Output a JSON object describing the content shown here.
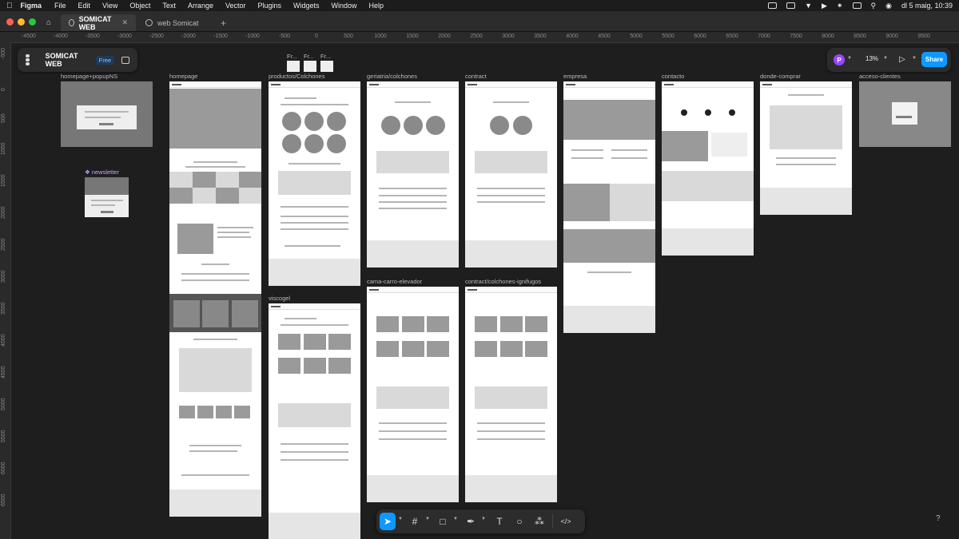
{
  "menubar": {
    "app": "Figma",
    "items": [
      "File",
      "Edit",
      "View",
      "Object",
      "Text",
      "Arrange",
      "Vector",
      "Plugins",
      "Widgets",
      "Window",
      "Help"
    ],
    "datetime": "dl 5 maig, 10:39"
  },
  "tabs": [
    {
      "label": "SOMICAT WEB",
      "active": true
    },
    {
      "label": "web Somicat",
      "active": false
    }
  ],
  "file": {
    "name": "SOMICAT WEB",
    "plan_badge": "Free"
  },
  "right_panel": {
    "avatar_initial": "P",
    "zoom": "13%",
    "share_label": "Share"
  },
  "ruler_h": [
    "-4500",
    "-4000",
    "-3500",
    "-3000",
    "-2500",
    "-2000",
    "-1500",
    "-1000",
    "-500",
    "0",
    "500",
    "1000",
    "1500",
    "2000",
    "2500",
    "3000",
    "3500",
    "4000",
    "4500",
    "5000",
    "5500",
    "6000",
    "6500",
    "7000",
    "7500",
    "8000",
    "8500",
    "9000",
    "9500"
  ],
  "ruler_v": [
    "-500",
    "0",
    "500",
    "1000",
    "1500",
    "2000",
    "2500",
    "3000",
    "3500",
    "4000",
    "4500",
    "5000",
    "5500",
    "6000",
    "6500"
  ],
  "frames": {
    "homepage_popup": "homepage+popupNS",
    "newsletter": "newsletter",
    "homepage": "homepage",
    "productos": "productos/Colchones",
    "viscogel": "viscogel",
    "geriatria": "geriatria/colchones",
    "cama": "cama-carro-elevador",
    "contract": "contract",
    "contract_ignifugos": "contract/colchones-ignifugos",
    "empresa": "empresa",
    "contacto": "contacto",
    "donde": "donde-comprar",
    "acceso": "acceso-clientes",
    "small_frames": [
      "Fr...",
      "Fr...",
      "Fr..."
    ]
  },
  "help": "?"
}
